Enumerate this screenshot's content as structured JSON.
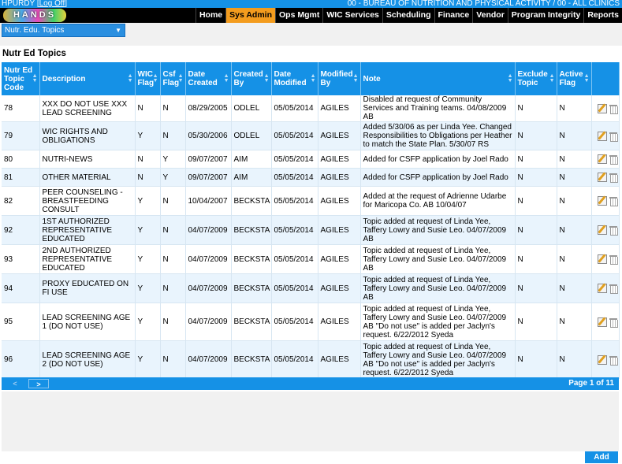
{
  "topbar": {
    "user": "HPURDY",
    "logoff": "Log Off",
    "agency": "00 - BUREAU OF NUTRITION AND PHYSICAL ACTIVITY / 00 - ALL CLINICS"
  },
  "logo": {
    "text": "HANDS"
  },
  "nav": {
    "items": [
      {
        "label": "Home"
      },
      {
        "label": "Sys Admin",
        "active": true
      },
      {
        "label": "Ops Mgmt"
      },
      {
        "label": "WIC Services"
      },
      {
        "label": "Scheduling"
      },
      {
        "label": "Finance"
      },
      {
        "label": "Vendor"
      },
      {
        "label": "Program Integrity"
      },
      {
        "label": "Reports"
      }
    ]
  },
  "dropdown": {
    "selected": "Nutr. Edu. Topics"
  },
  "page": {
    "title": "Nutr Ed Topics"
  },
  "table": {
    "headers": [
      "Nutr Ed Topic Code",
      "Description",
      "WIC Flag",
      "Csf Flag",
      "Date Created",
      "Created By",
      "Date Modified",
      "Modified By",
      "Note",
      "Exclude Topic",
      "Active Flag"
    ],
    "rows": [
      [
        "78",
        "XXX DO NOT USE XXX LEAD SCREENING",
        "N",
        "N",
        "08/29/2005",
        "ODLEL",
        "05/05/2014",
        "AGILES",
        "Disabled at request of Community Services and Training teams. 04/08/2009 AB",
        "N",
        "N"
      ],
      [
        "79",
        "WIC RIGHTS AND OBLIGATIONS",
        "Y",
        "N",
        "05/30/2006",
        "ODLEL",
        "05/05/2014",
        "AGILES",
        "Added 5/30/06 as per Linda Yee. Changed Responsibilities to Obligations per Heather to match the State Plan. 5/30/07 RS",
        "N",
        "N"
      ],
      [
        "80",
        "NUTRI-NEWS",
        "N",
        "Y",
        "09/07/2007",
        "AIM",
        "05/05/2014",
        "AGILES",
        "Added for CSFP application by Joel Rado",
        "N",
        "N"
      ],
      [
        "81",
        "OTHER MATERIAL",
        "N",
        "Y",
        "09/07/2007",
        "AIM",
        "05/05/2014",
        "AGILES",
        "Added for CSFP application by Joel Rado",
        "N",
        "N"
      ],
      [
        "82",
        "PEER COUNSELING - BREASTFEEDING CONSULT",
        "Y",
        "N",
        "10/04/2007",
        "BECKSTA",
        "05/05/2014",
        "AGILES",
        "Added at the request of Adrienne Udarbe for Maricopa Co. AB 10/04/07",
        "N",
        "N"
      ],
      [
        "92",
        "1ST AUTHORIZED REPRESENTATIVE EDUCATED",
        "Y",
        "N",
        "04/07/2009",
        "BECKSTA",
        "05/05/2014",
        "AGILES",
        "Topic added at request of Linda Yee, Taffery Lowry and Susie Leo. 04/07/2009 AB",
        "N",
        "N"
      ],
      [
        "93",
        "2ND AUTHORIZED REPRESENTATIVE EDUCATED",
        "Y",
        "N",
        "04/07/2009",
        "BECKSTA",
        "05/05/2014",
        "AGILES",
        "Topic added at request of Linda Yee, Taffery Lowry and Susie Leo. 04/07/2009 AB",
        "N",
        "N"
      ],
      [
        "94",
        "PROXY EDUCATED ON FI USE",
        "Y",
        "N",
        "04/07/2009",
        "BECKSTA",
        "05/05/2014",
        "AGILES",
        "Topic added at request of Linda Yee, Taffery Lowry and Susie Leo. 04/07/2009 AB",
        "N",
        "N"
      ],
      [
        "95",
        "LEAD SCREENING AGE 1 (DO NOT USE)",
        "Y",
        "N",
        "04/07/2009",
        "BECKSTA",
        "05/05/2014",
        "AGILES",
        "Topic added at request of Linda Yee, Taffery Lowry and Susie Leo. 04/07/2009 AB \"Do not use\" is added per Jaclyn's request. 6/22/2012 Syeda",
        "N",
        "N"
      ],
      [
        "96",
        "LEAD SCREENING AGE 2 (DO NOT USE)",
        "Y",
        "N",
        "04/07/2009",
        "BECKSTA",
        "05/05/2014",
        "AGILES",
        "Topic added at request of Linda Yee, Taffery Lowry and Susie Leo. 04/07/2009 AB \"Do not use\" is added per Jaclyn's request. 6/22/2012 Syeda",
        "N",
        "N"
      ]
    ]
  },
  "pager": {
    "prev": "<",
    "next": ">",
    "info": "Page 1 of 11"
  },
  "actions": {
    "add_label": "Add"
  },
  "colors": {
    "accent": "#1591e6",
    "nav_active": "#f39c1e",
    "row_alt": "#e9f4fd"
  }
}
